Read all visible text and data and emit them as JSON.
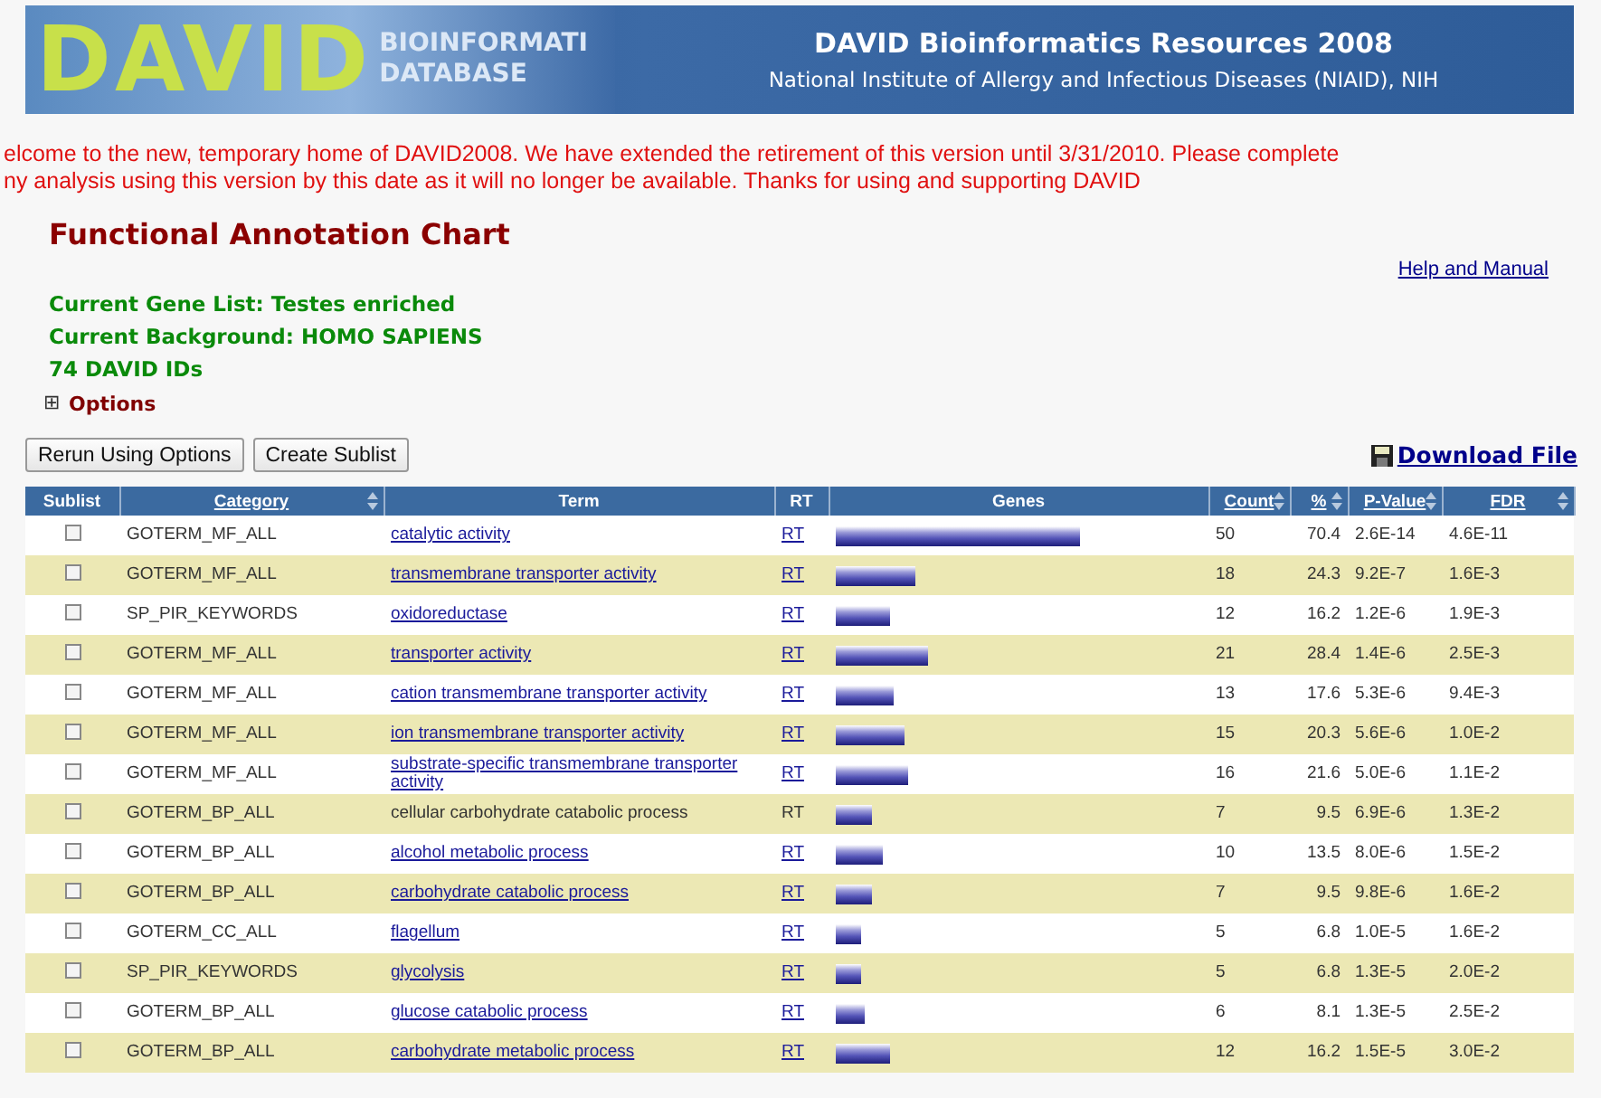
{
  "banner": {
    "logo_letters": "DAVID",
    "logo_line1": "BIOINFORMATI",
    "logo_line2": "DATABASE",
    "title": "DAVID Bioinformatics Resources 2008",
    "subtitle": "National Institute of Allergy and Infectious Diseases (NIAID), NIH"
  },
  "notice": [
    "elcome to the new, temporary home of DAVID2008. We have extended the retirement of this version until 3/31/2010. Please complete",
    "ny analysis using this version by this date as it will no longer be available. Thanks for using and supporting DAVID"
  ],
  "page_title": "Functional Annotation Chart",
  "help_link": "Help and Manual",
  "info": [
    "Current Gene List: Testes enriched",
    "Current Background: HOMO SAPIENS",
    "74 DAVID IDs"
  ],
  "options": {
    "icon": "⊞",
    "label": "Options",
    "expanded": false
  },
  "buttons": [
    "Rerun Using Options",
    "Create Sublist"
  ],
  "download_link": "Download File",
  "table": {
    "columns": [
      {
        "label": "Sublist",
        "sortable": false
      },
      {
        "label": "Category",
        "sortable": true
      },
      {
        "label": "Term",
        "sortable": false
      },
      {
        "label": "RT",
        "sortable": false
      },
      {
        "label": "Genes",
        "sortable": false
      },
      {
        "label": "Count",
        "sortable": true
      },
      {
        "label": "%",
        "sortable": true
      },
      {
        "label": "P-Value",
        "sortable": true
      },
      {
        "label": "FDR",
        "sortable": true
      }
    ],
    "rows": [
      {
        "checked": false,
        "category": "GOTERM_MF_ALL",
        "term": "catalytic activity",
        "linked": true,
        "rt": "RT",
        "level": 0.67,
        "count": "50",
        "percent": "70.4",
        "p_value": "2.6E-14",
        "fdr": "4.6E-11"
      },
      {
        "checked": false,
        "category": "GOTERM_MF_ALL",
        "term": "transmembrane transporter activity",
        "linked": true,
        "rt": "RT",
        "level": 0.22,
        "count": "18",
        "percent": "24.3",
        "p_value": "9.2E-7",
        "fdr": "1.6E-3"
      },
      {
        "checked": false,
        "category": "SP_PIR_KEYWORDS",
        "term": "oxidoreductase",
        "linked": true,
        "rt": "RT",
        "level": 0.15,
        "count": "12",
        "percent": "16.2",
        "p_value": "1.2E-6",
        "fdr": "1.9E-3"
      },
      {
        "checked": false,
        "category": "GOTERM_MF_ALL",
        "term": "transporter activity",
        "linked": true,
        "rt": "RT",
        "level": 0.25,
        "count": "21",
        "percent": "28.4",
        "p_value": "1.4E-6",
        "fdr": "2.5E-3"
      },
      {
        "checked": false,
        "category": "GOTERM_MF_ALL",
        "term": "cation transmembrane transporter activity",
        "linked": true,
        "rt": "RT",
        "level": 0.16,
        "count": "13",
        "percent": "17.6",
        "p_value": "5.3E-6",
        "fdr": "9.4E-3"
      },
      {
        "checked": false,
        "category": "GOTERM_MF_ALL",
        "term": "ion transmembrane transporter activity",
        "linked": true,
        "rt": "RT",
        "level": 0.19,
        "count": "15",
        "percent": "20.3",
        "p_value": "5.6E-6",
        "fdr": "1.0E-2"
      },
      {
        "checked": false,
        "category": "GOTERM_MF_ALL",
        "term": "substrate-specific transmembrane transporter activity",
        "linked": true,
        "rt": "RT",
        "level": 0.2,
        "count": "16",
        "percent": "21.6",
        "p_value": "5.0E-6",
        "fdr": "1.1E-2"
      },
      {
        "checked": false,
        "category": "GOTERM_BP_ALL",
        "term": "cellular carbohydrate catabolic process",
        "linked": false,
        "rt": "RT",
        "level": 0.1,
        "count": "7",
        "percent": "9.5",
        "p_value": "6.9E-6",
        "fdr": "1.3E-2"
      },
      {
        "checked": false,
        "category": "GOTERM_BP_ALL",
        "term": "alcohol metabolic process",
        "linked": true,
        "rt": "RT",
        "level": 0.13,
        "count": "10",
        "percent": "13.5",
        "p_value": "8.0E-6",
        "fdr": "1.5E-2"
      },
      {
        "checked": false,
        "category": "GOTERM_BP_ALL",
        "term": "carbohydrate catabolic process",
        "linked": true,
        "rt": "RT",
        "level": 0.1,
        "count": "7",
        "percent": "9.5",
        "p_value": "9.8E-6",
        "fdr": "1.6E-2"
      },
      {
        "checked": false,
        "category": "GOTERM_CC_ALL",
        "term": "flagellum",
        "linked": true,
        "rt": "RT",
        "level": 0.07,
        "count": "5",
        "percent": "6.8",
        "p_value": "1.0E-5",
        "fdr": "1.6E-2"
      },
      {
        "checked": false,
        "category": "SP_PIR_KEYWORDS",
        "term": "glycolysis",
        "linked": true,
        "rt": "RT",
        "level": 0.07,
        "count": "5",
        "percent": "6.8",
        "p_value": "1.3E-5",
        "fdr": "2.0E-2"
      },
      {
        "checked": false,
        "category": "GOTERM_BP_ALL",
        "term": "glucose catabolic process",
        "linked": true,
        "rt": "RT",
        "level": 0.08,
        "count": "6",
        "percent": "8.1",
        "p_value": "1.3E-5",
        "fdr": "2.5E-2"
      },
      {
        "checked": false,
        "category": "GOTERM_BP_ALL",
        "term": "carbohydrate metabolic process",
        "linked": true,
        "rt": "RT",
        "level": 0.15,
        "count": "12",
        "percent": "16.2",
        "p_value": "1.5E-5",
        "fdr": "3.0E-2"
      }
    ]
  }
}
